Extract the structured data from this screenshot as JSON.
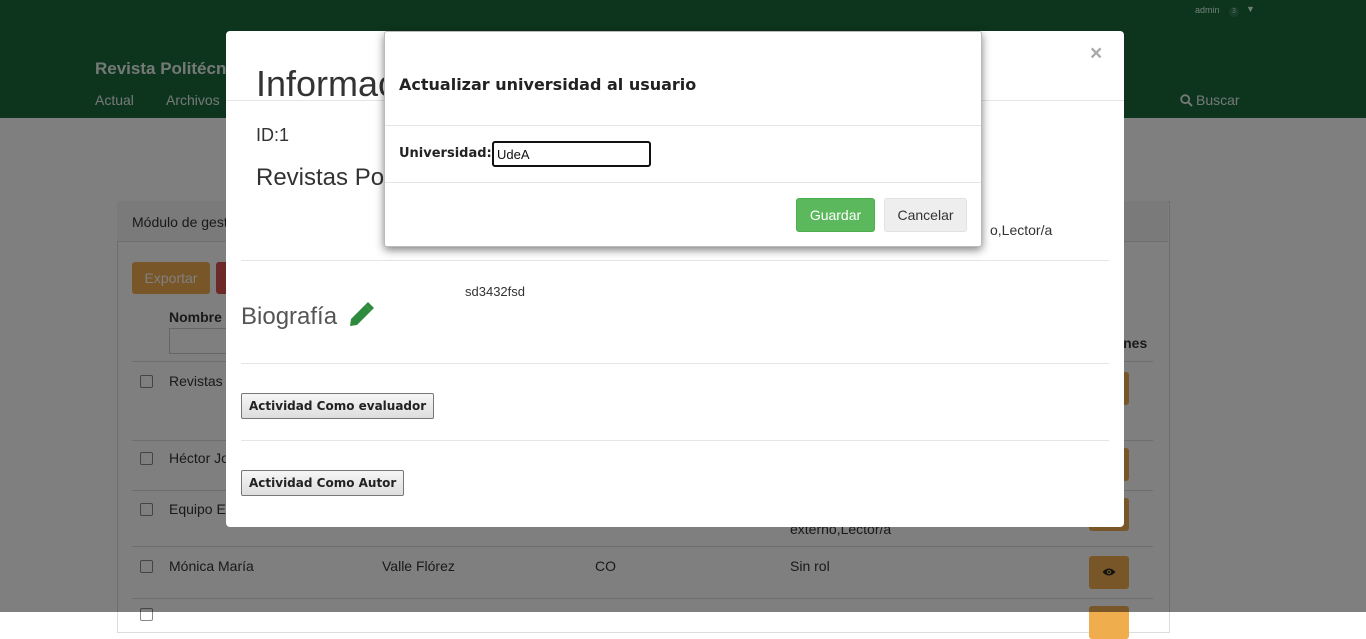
{
  "header": {
    "admin_user": "admin",
    "admin_badge": "3",
    "site_title": "Revista Politécnica",
    "nav": [
      "Actual",
      "Archivos"
    ],
    "search_label": "Buscar"
  },
  "panel": {
    "title": "Módulo de gestión de usuarios",
    "export_label": "Exportar",
    "column_name": "Nombre",
    "column_actions": "Acciones",
    "rows": [
      {
        "name": "Revistas Politécnica",
        "surname": "",
        "country": "",
        "roles": ""
      },
      {
        "name": "Héctor José",
        "surname": "",
        "country": "",
        "roles": ""
      },
      {
        "name": "Equipo Editorial",
        "surname": "",
        "country": "",
        "roles": "externo,Lector/a"
      },
      {
        "name": "Mónica María",
        "surname": "Valle Flórez",
        "country": "CO",
        "roles": "Sin rol"
      }
    ]
  },
  "info_modal": {
    "title": "Información del usuario",
    "close_symbol": "×",
    "id_label": "ID:1",
    "name": "Revistas Politécnica",
    "roles": "o,Lector/a",
    "biography_label": "Biografía",
    "biography_text": "sd3432fsd",
    "evaluator_button": "Actividad Como evaluador",
    "author_button": "Actividad Como Autor"
  },
  "university_modal": {
    "title": "Actualizar universidad al usuario",
    "field_label": "Universidad:",
    "field_value": "UdeA",
    "save_label": "Guardar",
    "cancel_label": "Cancelar"
  },
  "colors": {
    "header_bg": "#1a6b3c",
    "save_button": "#5cb85c",
    "pencil_icon": "#2e8b3e",
    "warning_button": "#f0ad4e"
  },
  "icons": [
    "search-icon",
    "pencil-icon",
    "eye-icon",
    "caret-down-icon",
    "close-icon"
  ]
}
